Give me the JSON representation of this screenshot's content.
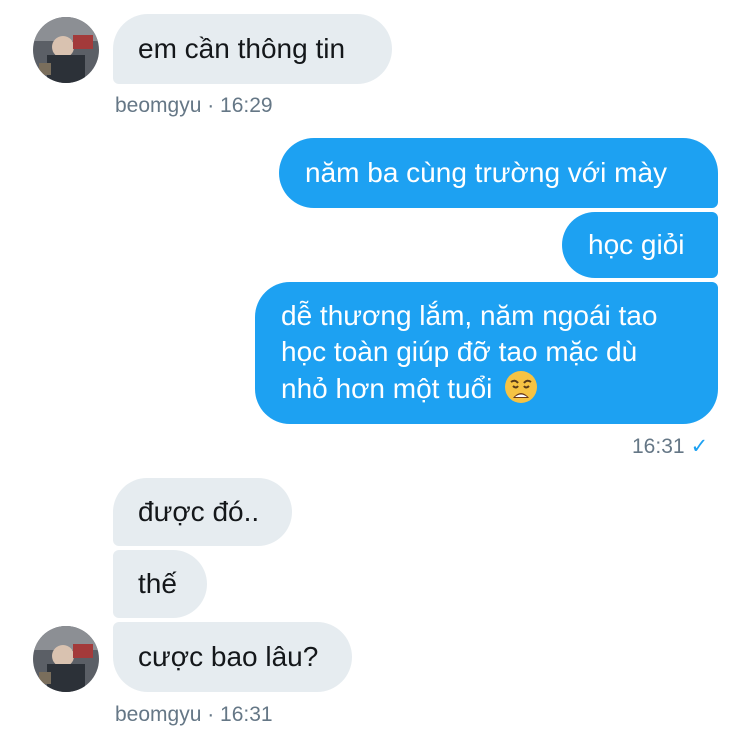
{
  "thread": {
    "incoming_1": {
      "text": "em cần thông tin",
      "meta": "beomgyu · 16:29"
    },
    "outgoing": {
      "m1": "năm ba cùng trường với mày",
      "m2": "học giỏi",
      "m3_line1": "dễ thương lắm, năm ngoái tao",
      "m3_line2": "học toàn giúp đỡ tao mặc dù",
      "m3_line3": "nhỏ hơn một tuổi",
      "m3_emoji": "weary-face-emoji",
      "time": "16:31",
      "status_icon": "checkmark-icon",
      "status_glyph": "✓"
    },
    "incoming_2": {
      "m1": "được đó..",
      "m2": "thế",
      "m3": "cược bao lâu?",
      "meta": "beomgyu · 16:31"
    }
  },
  "colors": {
    "sent_bubble": "#1da1f2",
    "received_bubble": "#e6ecf0",
    "meta_text": "#657786"
  }
}
